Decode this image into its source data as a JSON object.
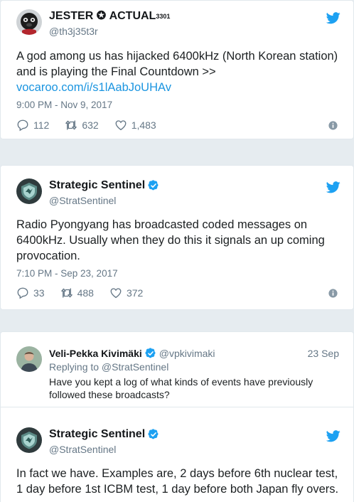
{
  "tweets": [
    {
      "name": "JESTER",
      "name_symbol": "✪",
      "name_suffix": "ACTUAL",
      "name_sup": "3301",
      "handle": "@th3j35t3r",
      "text": "A god among us has hijacked 6400kHz (North Korean station) and is playing the Final Countdown >>",
      "link": "vocaroo.com/i/s1lAabJoUHAv",
      "time": "9:00 PM - Nov 9, 2017",
      "replies": "112",
      "retweets": "632",
      "likes": "1,483"
    },
    {
      "name": "Strategic Sentinel",
      "handle": "@StratSentinel",
      "text": "Radio Pyongyang has broadcasted coded messages on 6400kHz. Usually when they do this it signals an up coming provocation.",
      "time": "7:10 PM - Sep 23, 2017",
      "replies": "33",
      "retweets": "488",
      "likes": "372"
    }
  ],
  "reply": {
    "name": "Veli-Pekka Kivimäki",
    "handle": "@vpkivimaki",
    "date": "23 Sep",
    "replying_to": "Replying to @StratSentinel",
    "text": "Have you kept a log of what kinds of events have previously followed these broadcasts?"
  },
  "answer": {
    "name": "Strategic Sentinel",
    "handle": "@StratSentinel",
    "text": "In fact we have. Examples are, 2 days before 6th nuclear test, 1 day before 1st ICBM test, 1 day before both Japan fly overs."
  },
  "colors": {
    "twitter_blue": "#1da1f2",
    "link_blue": "#1b95e0",
    "muted": "#657786",
    "border": "#e1e8ed",
    "background": "#e6ecf0"
  }
}
